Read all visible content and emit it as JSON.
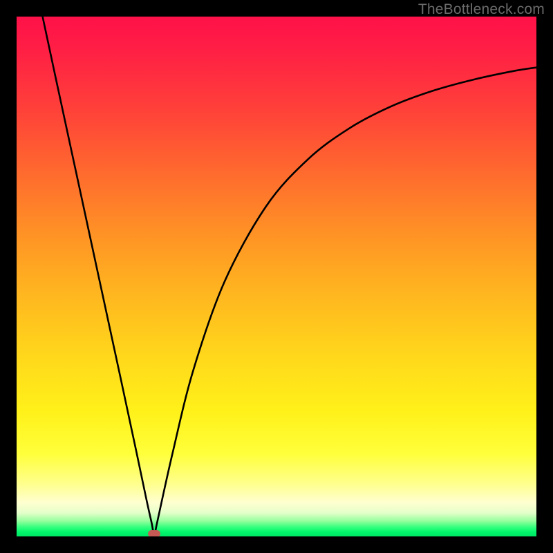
{
  "watermark": "TheBottleneck.com",
  "chart_data": {
    "type": "line",
    "title": "",
    "xlabel": "",
    "ylabel": "",
    "xlim": [
      0,
      100
    ],
    "ylim": [
      0,
      100
    ],
    "curve": {
      "x": [
        5,
        8,
        12,
        16,
        20,
        23,
        25,
        26,
        26.5,
        27,
        30,
        34,
        40,
        48,
        56,
        64,
        72,
        80,
        88,
        96,
        100
      ],
      "y": [
        100,
        86,
        67.5,
        49,
        30.5,
        16.5,
        7,
        2.5,
        0,
        2.5,
        16,
        32,
        49,
        63.5,
        72.5,
        78.5,
        82.7,
        85.7,
        87.9,
        89.6,
        90.2
      ]
    },
    "minimum": {
      "x": 26.5,
      "y": 0.4
    },
    "background_gradient": {
      "top_color": "#ff1149",
      "bottom_color": "#00e765"
    }
  }
}
